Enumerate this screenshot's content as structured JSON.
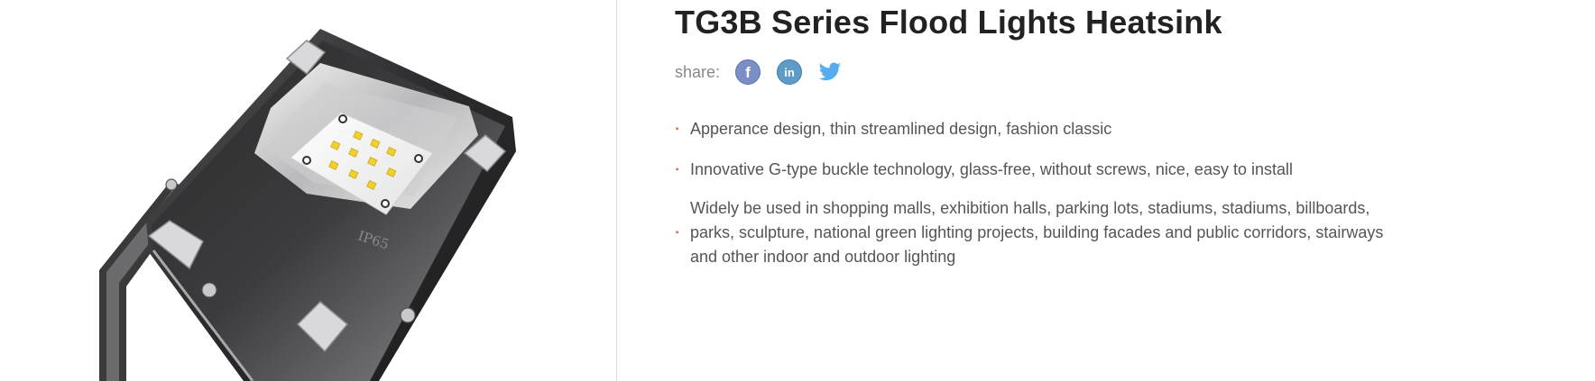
{
  "product": {
    "title": "TG3B Series Flood Lights Heatsink",
    "badge": "IP65"
  },
  "share": {
    "label": "share:",
    "icons": [
      "facebook-icon",
      "linkedin-icon",
      "twitter-icon"
    ]
  },
  "features": [
    "Apperance design, thin streamlined design, fashion classic",
    "Innovative G-type buckle technology, glass-free, without screws, nice, easy to install",
    "Widely be used in shopping malls, exhibition halls, parking lots, stadiums, stadiums, billboards, parks, sculpture, national green lighting projects, building facades and public corridors, stairways and other indoor and outdoor lighting"
  ],
  "colors": {
    "bullet": "#d4552a",
    "title": "#222222",
    "text": "#555555",
    "facebook": "#7b8fc6",
    "linkedin": "#5e9cc7",
    "twitter": "#55acee"
  }
}
